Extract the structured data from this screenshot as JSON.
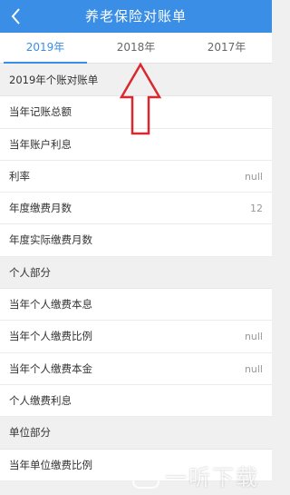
{
  "header": {
    "title": "养老保险对账单",
    "back_icon": "chevron-left-icon"
  },
  "tabs": [
    {
      "label": "2019年",
      "active": true
    },
    {
      "label": "2018年",
      "active": false
    },
    {
      "label": "2017年",
      "active": false
    }
  ],
  "rows": [
    {
      "type": "section",
      "label": "2019年个账对账单",
      "value": ""
    },
    {
      "type": "item",
      "label": "当年记账总额",
      "value": ""
    },
    {
      "type": "item",
      "label": "当年账户利息",
      "value": ""
    },
    {
      "type": "item",
      "label": "利率",
      "value": "null"
    },
    {
      "type": "item",
      "label": "年度缴费月数",
      "value": "12"
    },
    {
      "type": "item",
      "label": "年度实际缴费月数",
      "value": ""
    },
    {
      "type": "section",
      "label": "个人部分",
      "value": ""
    },
    {
      "type": "item",
      "label": "当年个人缴费本息",
      "value": ""
    },
    {
      "type": "item",
      "label": "当年个人缴费比例",
      "value": "null"
    },
    {
      "type": "item",
      "label": "当年个人缴费本金",
      "value": "null"
    },
    {
      "type": "item",
      "label": "个人缴费利息",
      "value": ""
    },
    {
      "type": "section",
      "label": "单位部分",
      "value": ""
    },
    {
      "type": "item",
      "label": "当年单位缴费比例",
      "value": ""
    }
  ],
  "annotation": {
    "icon": "red-up-arrow-icon",
    "color": "#d9282f"
  },
  "watermark": {
    "logo_icon": "watermark-logo-icon",
    "text": "一听下载"
  },
  "colors": {
    "accent": "#3a8ee6"
  }
}
